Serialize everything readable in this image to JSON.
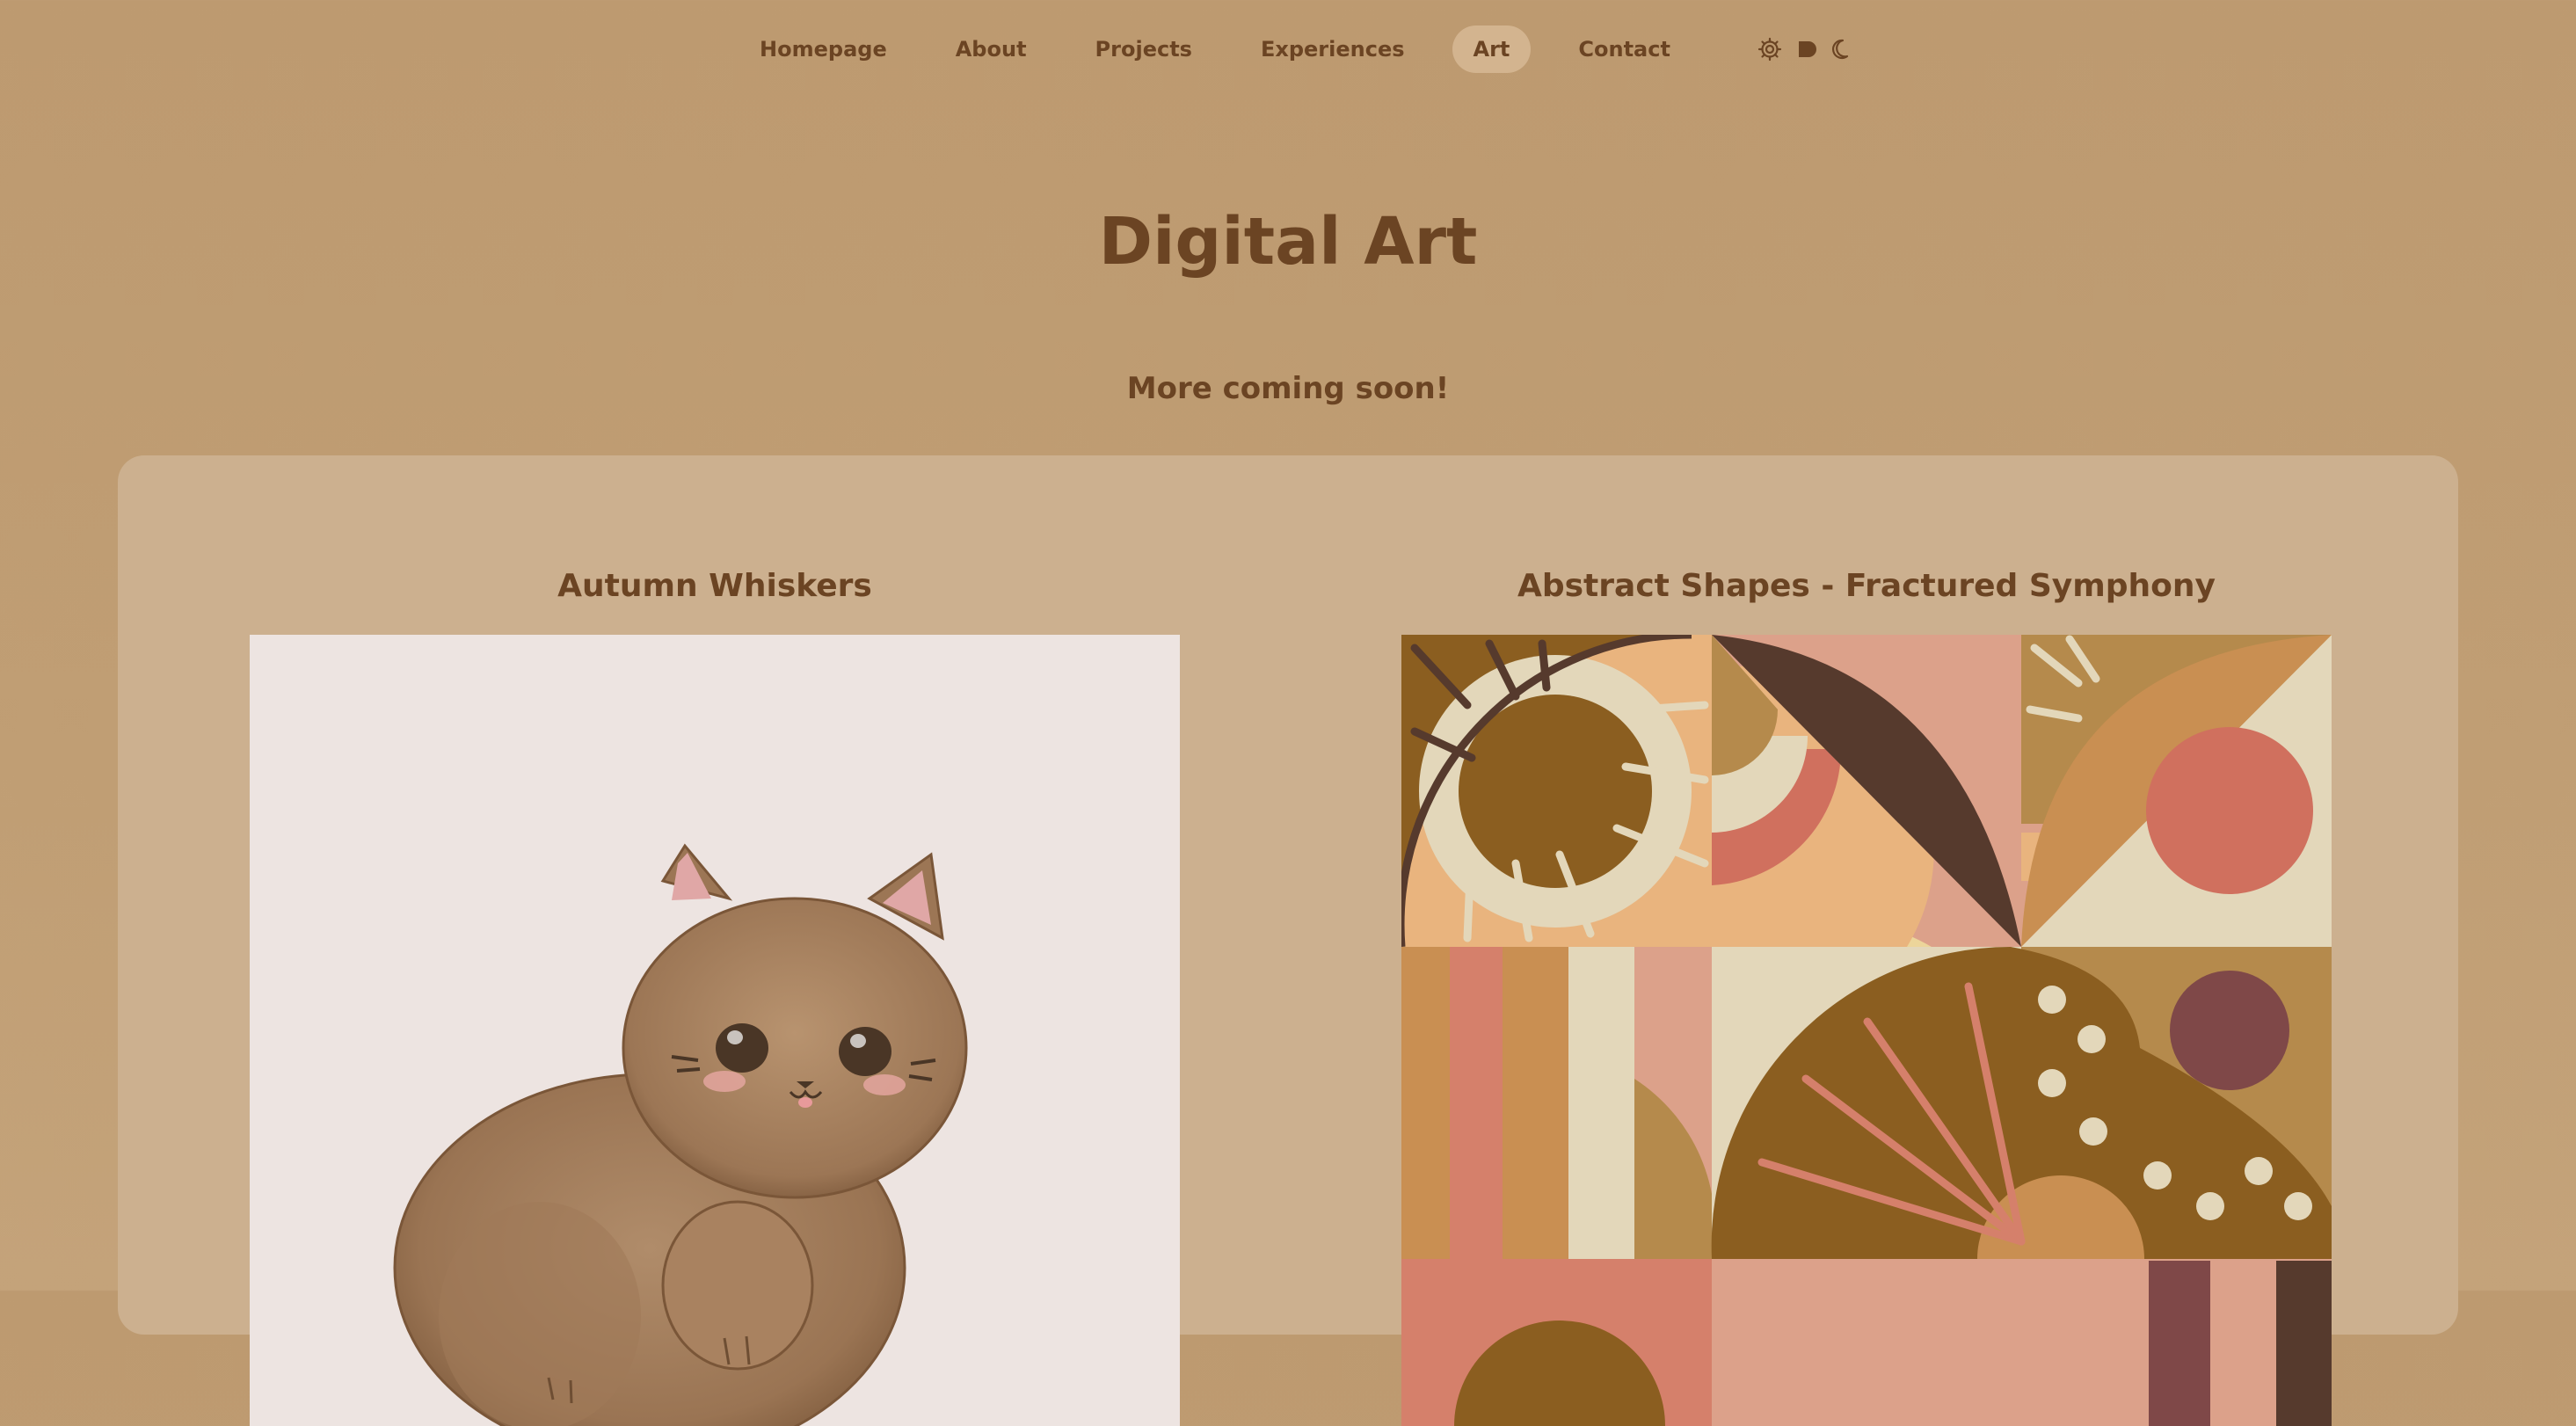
{
  "nav": {
    "items": [
      {
        "label": "Homepage"
      },
      {
        "label": "About"
      },
      {
        "label": "Projects"
      },
      {
        "label": "Experiences"
      },
      {
        "label": "Art"
      },
      {
        "label": "Contact"
      }
    ],
    "active": "Art",
    "theme_icons": [
      "gear-icon",
      "toggle-icon",
      "moon-icon"
    ]
  },
  "page": {
    "title": "Digital Art",
    "subtitle": "More coming soon!"
  },
  "gallery": {
    "items": [
      {
        "title": "Autumn Whiskers"
      },
      {
        "title": "Abstract Shapes - Fractured Symphony"
      }
    ]
  },
  "colors": {
    "background": "#bd9a70",
    "panel": "#ccb08f",
    "text": "#6b4423",
    "active_pill": "#d3b48f"
  }
}
